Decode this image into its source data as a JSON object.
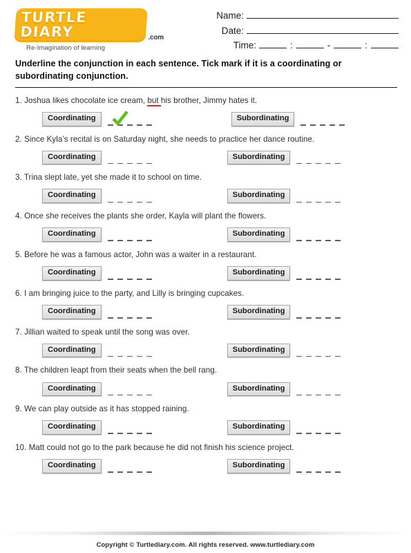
{
  "brand": {
    "logo_text": "TURTLE DIARY",
    "logo_suffix": ".com",
    "tagline": "Re-Imagination of learning"
  },
  "header_fields": {
    "name_label": "Name:",
    "date_label": "Date:",
    "time_label": "Time:",
    "time_colon_1": ":",
    "time_dash": "-",
    "time_colon_2": ":"
  },
  "instruction": "Underline the conjunction in each sentence. Tick mark if it is a coordinating or subordinating conjunction.",
  "option_labels": {
    "coordinating": "Coordinating",
    "subordinating": "Subordinating"
  },
  "colors": {
    "conjunction_underline": "#e02121",
    "checkmark": "#5cc217",
    "logo_orange": "#f7b519",
    "pill_background": "#e6e6e6"
  },
  "dash_count": 5,
  "questions": [
    {
      "number": "1.",
      "before": "Joshua likes chocolate ice cream, ",
      "conjunction": "but ",
      "after": "his brother, Jimmy hates it.",
      "full_text": "1. Joshua likes chocolate ice cream, but his brother, Jimmy hates it.",
      "checked": "coordinating"
    },
    {
      "number": "2.",
      "before": "Since Kyla’s recital is on Saturday night, she needs to practice her dance routine.",
      "conjunction": "",
      "after": "",
      "full_text": "2. Since Kyla’s recital is on Saturday night, she needs to practice her dance routine.",
      "checked": ""
    },
    {
      "number": "3.",
      "before": "Trina slept late, yet she made it to school on time.",
      "conjunction": "",
      "after": "",
      "full_text": "3. Trina slept late, yet she made it to school on time.",
      "checked": ""
    },
    {
      "number": "4.",
      "before": "Once she receives the plants she order, Kayla will plant the flowers.",
      "conjunction": "",
      "after": "",
      "full_text": "4. Once she receives the plants she order, Kayla will plant the flowers.",
      "checked": ""
    },
    {
      "number": "5.",
      "before": "Before he was a famous actor, John was a waiter in a restaurant.",
      "conjunction": "",
      "after": "",
      "full_text": "5. Before he was a famous actor, John was a waiter in a restaurant.",
      "checked": ""
    },
    {
      "number": "6.",
      "before": "I am bringing juice to the party, and Lilly is bringing cupcakes.",
      "conjunction": "",
      "after": "",
      "full_text": "6. I am bringing juice to the party, and Lilly is bringing cupcakes.",
      "checked": ""
    },
    {
      "number": "7.",
      "before": "Jillian waited to speak until the song was over.",
      "conjunction": "",
      "after": "",
      "full_text": "7. Jillian waited to speak until the song was over.",
      "checked": ""
    },
    {
      "number": "8.",
      "before": "The children leapt from their seats when the bell rang.",
      "conjunction": "",
      "after": "",
      "full_text": "8. The children leapt from their seats when the bell rang.",
      "checked": ""
    },
    {
      "number": "9.",
      "before": "We can play outside as it has stopped raining.",
      "conjunction": "",
      "after": "",
      "full_text": "9. We can play outside as it has stopped raining.",
      "checked": ""
    },
    {
      "number": "10.",
      "before": "Matt could not go to the park because he did not finish his science project.",
      "conjunction": "",
      "after": "",
      "full_text": "10. Matt could not go to the park because he did not finish his science project.",
      "checked": ""
    }
  ],
  "footer": {
    "copyright": "Copyright © Turtlediary.com. All rights reserved. www.turtlediary.com"
  }
}
